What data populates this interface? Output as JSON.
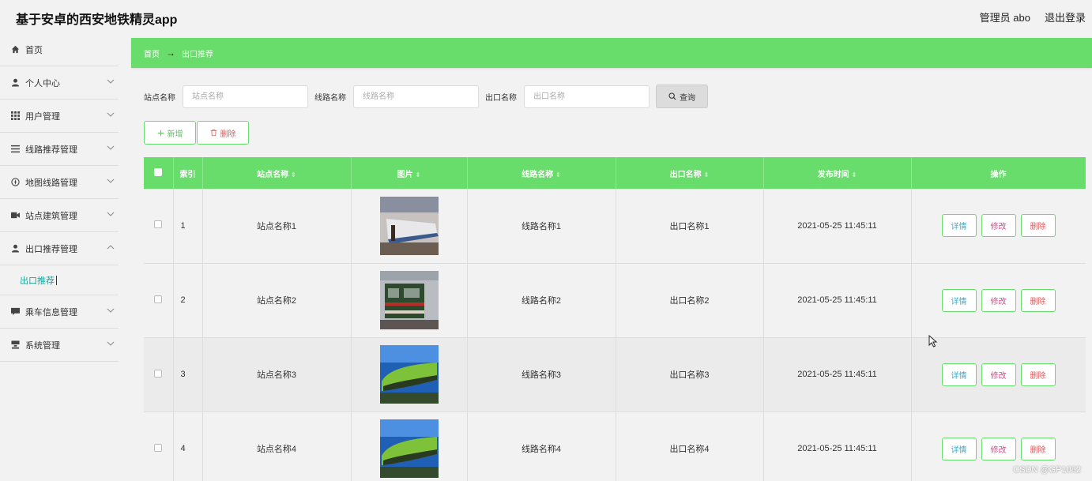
{
  "header": {
    "app_title": "基于安卓的西安地铁精灵app",
    "user_label": "管理员 abo",
    "logout_label": "退出登录"
  },
  "sidebar": {
    "items": [
      {
        "label": "首页",
        "icon": "home-icon",
        "has_arrow": false
      },
      {
        "label": "个人中心",
        "icon": "user-icon",
        "has_arrow": true
      },
      {
        "label": "用户管理",
        "icon": "grid-icon",
        "has_arrow": true
      },
      {
        "label": "线路推荐管理",
        "icon": "list-icon",
        "has_arrow": true
      },
      {
        "label": "地图线路管理",
        "icon": "compass-icon",
        "has_arrow": true
      },
      {
        "label": "站点建筑管理",
        "icon": "film-icon",
        "has_arrow": true
      },
      {
        "label": "出口推荐管理",
        "icon": "user-icon",
        "has_arrow": true,
        "expanded": true
      }
    ],
    "sub_item": "出口推荐",
    "items_after": [
      {
        "label": "乘车信息管理",
        "icon": "chat-icon",
        "has_arrow": true
      },
      {
        "label": "系统管理",
        "icon": "server-icon",
        "has_arrow": true
      }
    ]
  },
  "breadcrumb": {
    "home": "首页",
    "separator": "→",
    "current": "出口推荐"
  },
  "search": {
    "station_label": "站点名称",
    "station_placeholder": "站点名称",
    "line_label": "线路名称",
    "line_placeholder": "线路名称",
    "exit_label": "出口名称",
    "exit_placeholder": "出口名称",
    "query_label": "查询"
  },
  "actions": {
    "add_label": "新增",
    "delete_label": "删除"
  },
  "table": {
    "headers": {
      "index": "索引",
      "station": "站点名称",
      "image": "图片",
      "line": "线路名称",
      "exit": "出口名称",
      "time": "发布时间",
      "ops": "操作"
    },
    "rows": [
      {
        "index": "1",
        "station": "站点名称1",
        "line": "线路名称1",
        "exit": "出口名称1",
        "time": "2021-05-25 11:45:11",
        "image": "train-photo"
      },
      {
        "index": "2",
        "station": "站点名称2",
        "line": "线路名称2",
        "exit": "出口名称2",
        "time": "2021-05-25 11:45:11",
        "image": "train-photo"
      },
      {
        "index": "3",
        "station": "站点名称3",
        "line": "线路名称3",
        "exit": "出口名称3",
        "time": "2021-05-25 11:45:11",
        "image": "train-photo"
      },
      {
        "index": "4",
        "station": "站点名称4",
        "line": "线路名称4",
        "exit": "出口名称4",
        "time": "2021-05-25 11:45:11",
        "image": "train-photo"
      }
    ],
    "op_labels": {
      "detail": "详情",
      "edit": "修改",
      "delete": "删除"
    }
  },
  "watermark": "CSDN @GP1082",
  "colors": {
    "accent_green": "#69dd6b",
    "sub_active": "#1aa39a",
    "delete_red": "#e05a5a",
    "edit_pink": "#d64a8a",
    "detail_blue": "#3aa9c9"
  }
}
